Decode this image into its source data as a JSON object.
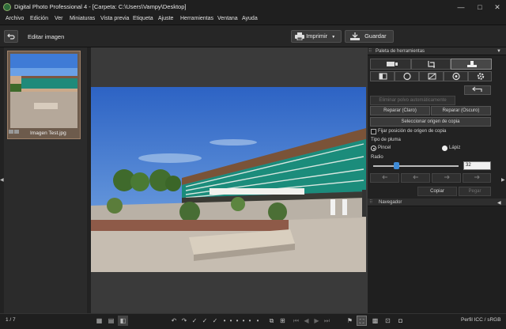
{
  "window": {
    "title": "Digital Photo Professional 4 - [Carpeta: C:\\Users\\Vampy\\Desktop]",
    "min": "—",
    "max": "□",
    "close": "✕"
  },
  "menu": [
    "Archivo",
    "Edición",
    "Ver",
    "Miniaturas",
    "Vista previa",
    "Etiqueta",
    "Ajuste",
    "Herramientas",
    "Ventana",
    "Ayuda"
  ],
  "toolbar": {
    "back_icon": "back-arrow-icon",
    "mode_label": "Editar imagen",
    "print_label": "Imprimir",
    "print_arrow": "▼",
    "save_label": "Guardar"
  },
  "thumbnail": {
    "filename": "Imagen Test.jpg"
  },
  "palette": {
    "title": "Paleta de herramientas",
    "tabs_top": [
      "raw-icon",
      "crop-icon",
      "stamp-icon"
    ],
    "tabs_bottom": [
      "histogram-icon",
      "color-wheel-icon",
      "curve-icon",
      "lens-icon",
      "gear-icon"
    ],
    "buttons": {
      "auto_repair": "Eliminar polvo automáticamente",
      "repair_light": "Reparar (Claro)",
      "repair_dark": "Reparar (Oscuro)",
      "select_source": "Seleccionar origen de copia",
      "fix_position": "Fijar posición de origen de copia",
      "pen_type": "Tipo de pluma",
      "brush": "Pincel",
      "pencil": "Lápiz",
      "radius": "Radio",
      "radius_value": "32",
      "copy": "Copiar",
      "paste": "Pegar"
    },
    "navigator": "Navegador"
  },
  "status": {
    "counter": "1 / 7",
    "profile": "Perfil ICC / sRGB"
  }
}
